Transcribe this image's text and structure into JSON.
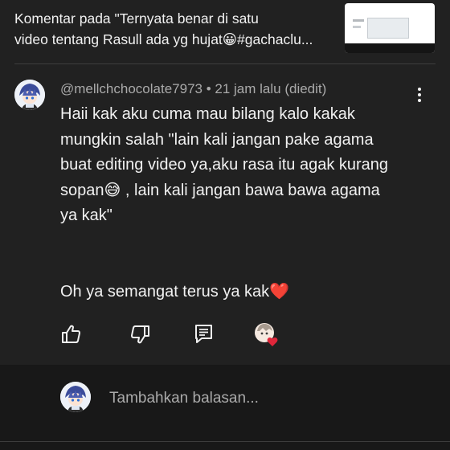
{
  "header": {
    "title_line1": "Komentar pada \"Ternyata benar di satu",
    "title_line2": "video tentang Rasull ada yg hujat😀#gachaclu..."
  },
  "comment": {
    "username": "@mellchchocolate7973",
    "separator": " • ",
    "time": "21 jam lalu (diedit)",
    "lines": [
      "Haii kak aku cuma mau bilang kalo kakak",
      "mungkin salah \"lain kali jangan pake agama",
      "buat editing video ya,aku rasa itu agak kurang",
      "sopan😅 , lain kali jangan bawa bawa agama",
      "ya kak\""
    ],
    "paragraph2": "Oh ya semangat terus ya kak❤️"
  },
  "actions": {
    "like_icon": "thumbs-up-icon",
    "dislike_icon": "thumbs-down-icon",
    "reply_icon": "comment-reply-icon",
    "creator_heart_icon": "creator-heart-icon"
  },
  "reply": {
    "placeholder": "Tambahkan balasan..."
  },
  "colors": {
    "background": "#212121",
    "reply_bar": "#181818",
    "text": "#f1f1f1",
    "secondary_text": "#aaaaaa",
    "heart": "#e0263a"
  }
}
